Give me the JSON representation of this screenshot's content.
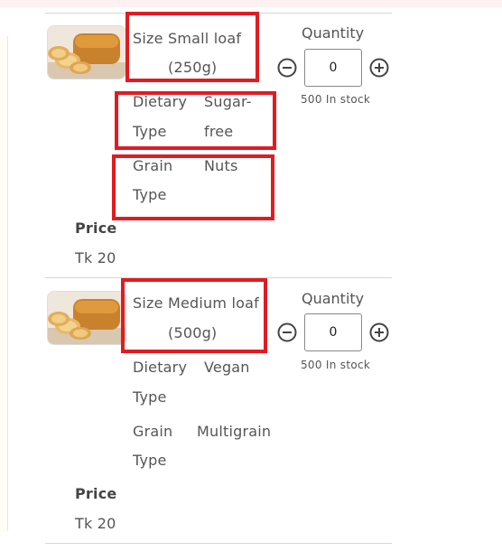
{
  "variants": [
    {
      "size_label": "Size",
      "size_value_line1": "Small loaf",
      "size_value_line2": "(250g)",
      "dietary_label_line1": "Dietary",
      "dietary_label_line2": "Type",
      "dietary_value_line1": "Sugar-",
      "dietary_value_line2": "free",
      "grain_label_line1": "Grain",
      "grain_label_line2": "Type",
      "grain_value": "Nuts",
      "price_label": "Price",
      "price_value": "Tk 20",
      "quantity_label": "Quantity",
      "quantity_value": "0",
      "stock_text": "500 In stock"
    },
    {
      "size_label": "Size",
      "size_value_line1": "Medium loaf",
      "size_value_line2": "(500g)",
      "dietary_label_line1": "Dietary",
      "dietary_label_line2": "Type",
      "dietary_value": "Vegan",
      "grain_label_line1": "Grain",
      "grain_label_line2": "Type",
      "grain_value": "Multigrain",
      "price_label": "Price",
      "price_value": "Tk 20",
      "quantity_label": "Quantity",
      "quantity_value": "0",
      "stock_text": "500 In stock"
    }
  ],
  "icons": {
    "product_image": "bread-loaf-image",
    "decrease": "minus-circle-icon",
    "increase": "plus-circle-icon"
  },
  "colors": {
    "highlight": "#e11b22",
    "divider": "#d6d6d6",
    "text": "#555555"
  }
}
